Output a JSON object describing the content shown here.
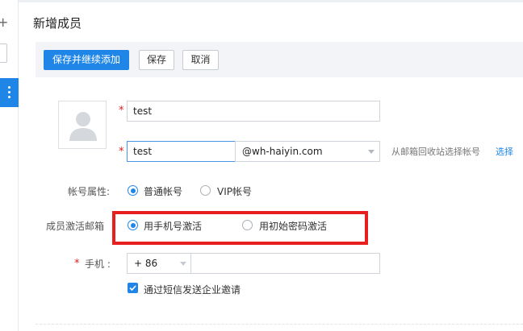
{
  "page": {
    "title": "新增成员"
  },
  "toolbar": {
    "save_continue_label": "保存并继续添加",
    "save_label": "保存",
    "cancel_label": "取消"
  },
  "form": {
    "name_value": "test",
    "account_value": "test",
    "domain_value": "@wh-haiyin.com",
    "recycle_hint": "从邮箱回收站选择帐号",
    "recycle_link": "选择",
    "account_type": {
      "label": "帐号属性:",
      "options": [
        {
          "label": "普通帐号",
          "selected": true
        },
        {
          "label": "VIP帐号",
          "selected": false
        }
      ]
    },
    "activation": {
      "label": "成员激活邮箱",
      "options": [
        {
          "label": "用手机号激活",
          "selected": true
        },
        {
          "label": "用初始密码激活",
          "selected": false
        }
      ]
    },
    "phone": {
      "label": "手机 :",
      "country_code": "+ 86",
      "number": ""
    },
    "sms_invite": {
      "label": "通过短信发送企业邀请",
      "checked": true
    }
  },
  "colors": {
    "accent": "#1f86e8",
    "required": "#e02020",
    "highlight_border": "#e81f1f"
  }
}
